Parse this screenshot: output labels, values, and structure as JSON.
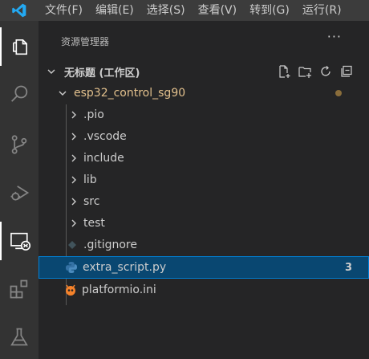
{
  "menu": [
    "文件(F)",
    "编辑(E)",
    "选择(S)",
    "查看(V)",
    "转到(G)",
    "运行(R)"
  ],
  "explorer": {
    "title": "资源管理器",
    "more": "···",
    "workspace": "无标题 (工作区)",
    "root_folder": "esp32_control_sg90",
    "items": [
      {
        "name": ".pio",
        "type": "folder"
      },
      {
        "name": ".vscode",
        "type": "folder"
      },
      {
        "name": "include",
        "type": "folder"
      },
      {
        "name": "lib",
        "type": "folder"
      },
      {
        "name": "src",
        "type": "folder"
      },
      {
        "name": "test",
        "type": "folder"
      },
      {
        "name": ".gitignore",
        "type": "file"
      },
      {
        "name": "extra_script.py",
        "type": "file",
        "badge": "3"
      },
      {
        "name": "platformio.ini",
        "type": "file"
      }
    ]
  },
  "icons": {
    "activity": [
      "files-icon",
      "search-icon",
      "source-control-icon",
      "run-debug-icon",
      "remote-explorer-icon",
      "extensions-icon",
      "testing-icon"
    ]
  },
  "colors": {
    "accent": "#007fd4",
    "selection": "#094771",
    "root_folder": "#e2c08d",
    "python": "#3572A5",
    "platformio": "#f5822a"
  }
}
